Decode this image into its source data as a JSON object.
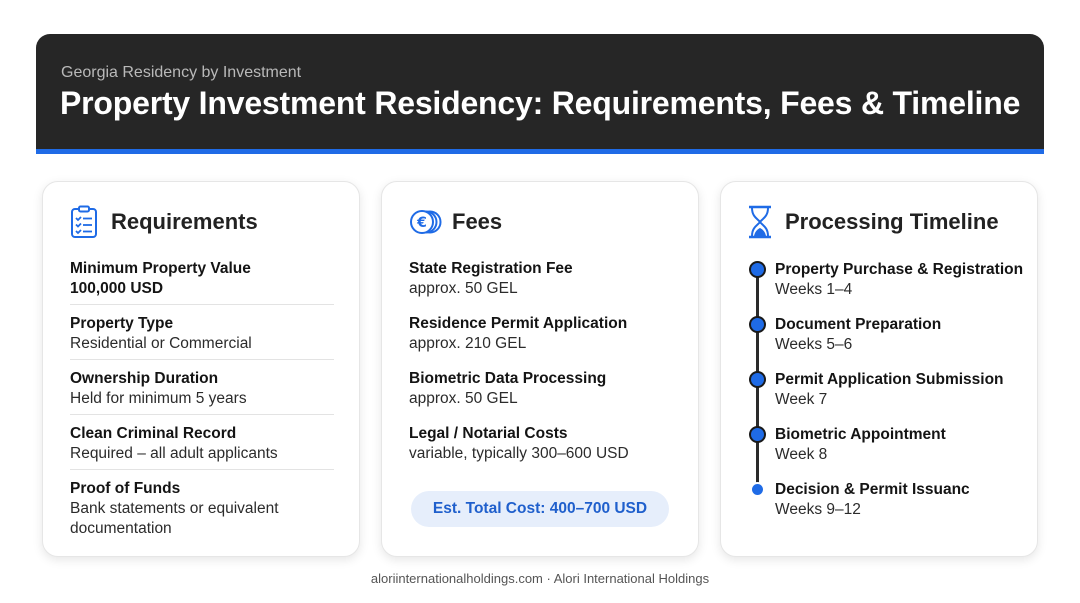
{
  "header": {
    "subtitle": "Georgia Residency by Investment",
    "title": "Property Investment Residency: Requirements, Fees & Timeline",
    "accent_color": "#1f6be6"
  },
  "requirements": {
    "icon": "clipboard-checklist-icon",
    "title": "Requirements",
    "items": [
      {
        "label": "Minimum Property Value",
        "value": "100,000 USD"
      },
      {
        "label": "Property Type",
        "value": "Residential or Commercial"
      },
      {
        "label": "Ownership Duration",
        "value": "Held for minimum 5 years"
      },
      {
        "label": "Clean Criminal Record",
        "value": "Required – all adult applicants"
      },
      {
        "label": "Proof of Funds",
        "value": "Bank statements or equivalent documentation"
      }
    ]
  },
  "fees": {
    "icon": "euro-coins-icon",
    "title": "Fees",
    "items": [
      {
        "label": "State Registration Fee",
        "value": "approx. 50 GEL"
      },
      {
        "label": "Residence Permit Application",
        "value": "approx. 210 GEL"
      },
      {
        "label": "Biometric Data Processing",
        "value": "approx. 50 GEL"
      },
      {
        "label": "Legal / Notarial Costs",
        "value": "variable, typically 300–600 USD"
      }
    ],
    "total": "Est. Total Cost: 400–700 USD"
  },
  "timeline": {
    "icon": "hourglass-icon",
    "title": "Processing Timeline",
    "steps": [
      {
        "label": "Property Purchase & Registration",
        "value": "Weeks 1–4"
      },
      {
        "label": "Document Preparation",
        "value": "Weeks 5–6"
      },
      {
        "label": "Permit Application Submission",
        "value": "Week 7"
      },
      {
        "label": "Biometric Appointment",
        "value": "Week 8"
      },
      {
        "label": "Decision & Permit Issuance",
        "value": "Weeks 9–12"
      }
    ]
  },
  "footer": {
    "text": "aloriinternationalholdings.com · Alori International Holdings"
  }
}
